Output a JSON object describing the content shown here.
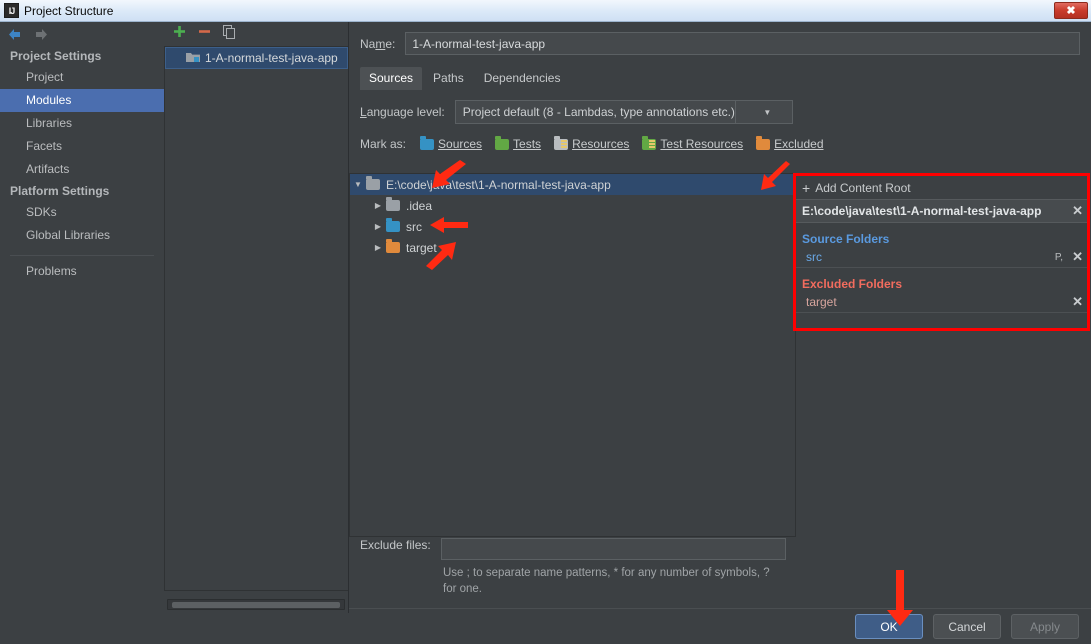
{
  "window": {
    "title": "Project Structure",
    "app_icon": "intellij-idea-icon",
    "close_label": "✖"
  },
  "nav": {
    "back_icon": "back-arrow-icon",
    "forward_icon": "forward-arrow-icon"
  },
  "sidebar": {
    "groups": [
      {
        "label": "Project Settings",
        "items": [
          {
            "label": "Project",
            "selected": false
          },
          {
            "label": "Modules",
            "selected": true
          },
          {
            "label": "Libraries",
            "selected": false
          },
          {
            "label": "Facets",
            "selected": false
          },
          {
            "label": "Artifacts",
            "selected": false
          }
        ]
      },
      {
        "label": "Platform Settings",
        "items": [
          {
            "label": "SDKs",
            "selected": false
          },
          {
            "label": "Global Libraries",
            "selected": false
          }
        ]
      }
    ],
    "problems_label": "Problems",
    "help_label": "?"
  },
  "module_list": {
    "toolbar": {
      "add_label": "+",
      "remove_label": "–",
      "copy_icon": "copy-icon"
    },
    "items": [
      {
        "label": "1-A-normal-test-java-app",
        "icon": "module-folder-icon",
        "selected": true
      }
    ]
  },
  "main": {
    "name_label": "Name:",
    "name_value": "1-A-normal-test-java-app",
    "tabs": [
      {
        "label": "Sources",
        "active": true
      },
      {
        "label": "Paths",
        "active": false
      },
      {
        "label": "Dependencies",
        "active": false
      }
    ],
    "language_level_label": "Language level:",
    "language_level_value": "Project default (8 - Lambdas, type annotations etc.)",
    "dropdown_icon": "chevron-down-icon",
    "mark_as_label": "Mark as:",
    "mark_as_options": [
      {
        "label": "Sources",
        "color": "#3592c4",
        "icon": "folder-sources-icon"
      },
      {
        "label": "Tests",
        "color": "#62a844",
        "icon": "folder-tests-icon"
      },
      {
        "label": "Resources",
        "color": "#9aa0a6",
        "icon": "folder-resources-icon"
      },
      {
        "label": "Test Resources",
        "color": "#b9bdc0",
        "icon": "folder-test-resources-icon"
      },
      {
        "label": "Excluded",
        "color": "#e08a3c",
        "icon": "folder-excluded-icon"
      }
    ],
    "tree": [
      {
        "label": "E:\\code\\java\\test\\1-A-normal-test-java-app",
        "depth": 0,
        "expanded": true,
        "folder": "grey",
        "selected": true
      },
      {
        "label": ".idea",
        "depth": 1,
        "expanded": false,
        "folder": "grey",
        "selected": false
      },
      {
        "label": "src",
        "depth": 1,
        "expanded": false,
        "folder": "blue",
        "selected": false
      },
      {
        "label": "target",
        "depth": 1,
        "expanded": false,
        "folder": "orange",
        "selected": false
      }
    ],
    "exclude_files_label": "Exclude files:",
    "exclude_files_value": "",
    "exclude_hint": "Use ; to separate name patterns, * for any number of symbols, ? for one."
  },
  "detail_panel": {
    "add_content_root_label": "Add Content Root",
    "add_icon": "plus-icon",
    "content_root_path": "E:\\code\\java\\test\\1-A-normal-test-java-app",
    "remove_icon": "close-icon",
    "source_folders_label": "Source Folders",
    "source_folders": [
      {
        "name": "src",
        "prefix": "P,"
      }
    ],
    "excluded_folders_label": "Excluded Folders",
    "excluded_folders": [
      {
        "name": "target"
      }
    ],
    "highlight_color": "#ff0000"
  },
  "buttons": {
    "ok": "OK",
    "cancel": "Cancel",
    "apply": "Apply"
  },
  "annotations": {
    "color": "#ff2a12",
    "arrow_targets": [
      "mark-as-sources",
      "mark-as-excluded",
      "tree-src",
      "tree-target",
      "ok-button"
    ]
  }
}
